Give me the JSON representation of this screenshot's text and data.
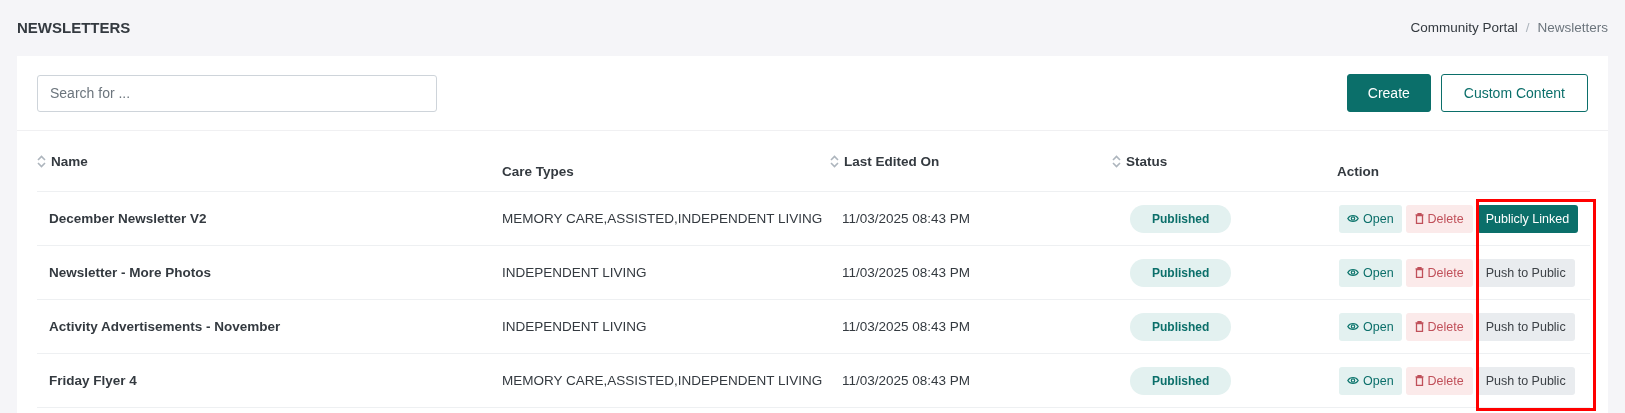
{
  "page_title": "NEWSLETTERS",
  "breadcrumb_separator": "/",
  "breadcrumb": [
    {
      "label": "Community Portal",
      "current": false
    },
    {
      "label": "Newsletters",
      "current": true
    }
  ],
  "search": {
    "placeholder": "Search for ..."
  },
  "buttons": [
    {
      "label": "Create",
      "kind": "primary"
    },
    {
      "label": "Custom Content",
      "kind": "outline"
    }
  ],
  "table": {
    "columns": [
      {
        "label": "Name",
        "sortable": true
      },
      {
        "label": "Care Types",
        "sortable": false
      },
      {
        "label": "Last Edited On",
        "sortable": true
      },
      {
        "label": "Status",
        "sortable": true
      },
      {
        "label": "Action",
        "sortable": false
      }
    ],
    "rows": [
      {
        "name": "December Newsletter V2",
        "care_types": "MEMORY CARE,ASSISTED,INDEPENDENT LIVING",
        "last_edited": "11/03/2025 08:43 PM",
        "status": "Published",
        "open": "Open",
        "delete": "Delete",
        "public": {
          "label": "Publicly Linked",
          "linked": true
        }
      },
      {
        "name": "Newsletter - More Photos",
        "care_types": "INDEPENDENT LIVING",
        "last_edited": "11/03/2025 08:43 PM",
        "status": "Published",
        "open": "Open",
        "delete": "Delete",
        "public": {
          "label": "Push to Public",
          "linked": false
        }
      },
      {
        "name": "Activity Advertisements - November",
        "care_types": "INDEPENDENT LIVING",
        "last_edited": "11/03/2025 08:43 PM",
        "status": "Published",
        "open": "Open",
        "delete": "Delete",
        "public": {
          "label": "Push to Public",
          "linked": false
        }
      },
      {
        "name": "Friday Flyer 4",
        "care_types": "MEMORY CARE,ASSISTED,INDEPENDENT LIVING",
        "last_edited": "11/03/2025 08:43 PM",
        "status": "Published",
        "open": "Open",
        "delete": "Delete",
        "public": {
          "label": "Push to Public",
          "linked": false
        }
      }
    ]
  }
}
